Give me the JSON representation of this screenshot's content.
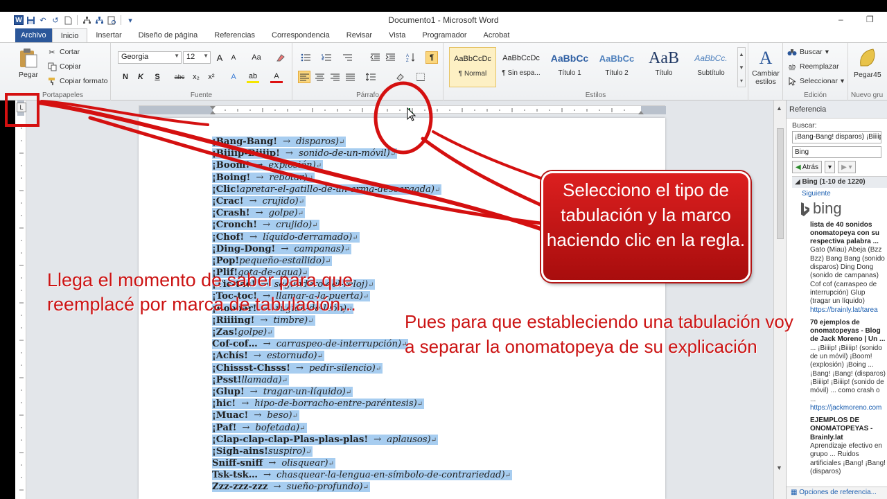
{
  "window": {
    "title": "Documento1 - Microsoft Word",
    "minimize": "–",
    "restore": "❐"
  },
  "qat": {
    "logo": "W",
    "undo": "↶",
    "redo": "↺"
  },
  "tabs": [
    {
      "label": "Archivo"
    },
    {
      "label": "Inicio"
    },
    {
      "label": "Insertar"
    },
    {
      "label": "Diseño de página"
    },
    {
      "label": "Referencias"
    },
    {
      "label": "Correspondencia"
    },
    {
      "label": "Revisar"
    },
    {
      "label": "Vista"
    },
    {
      "label": "Programador"
    },
    {
      "label": "Acrobat"
    }
  ],
  "ribbon": {
    "clipboard": {
      "label": "Portapapeles",
      "paste": "Pegar",
      "cut": "Cortar",
      "copy": "Copiar",
      "format_painter": "Copiar formato"
    },
    "font": {
      "label": "Fuente",
      "name": "Georgia",
      "size": "12",
      "grow": "A",
      "shrink": "A",
      "case": "Aa",
      "bold": "N",
      "italic": "K",
      "underline": "S",
      "strike": "abc",
      "sub": "x₂",
      "sup": "x²",
      "effects": "A",
      "highlight": "ab",
      "color": "A"
    },
    "paragraph": {
      "label": "Párrafo",
      "show_marks": "¶"
    },
    "styles": {
      "label": "Estilos",
      "items": [
        {
          "sample": "AaBbCcDc",
          "name": "¶ Normal"
        },
        {
          "sample": "AaBbCcDc",
          "name": "¶ Sin espa..."
        },
        {
          "sample": "AaBbCc",
          "name": "Título 1"
        },
        {
          "sample": "AaBbCc",
          "name": "Título 2"
        },
        {
          "sample": "AaB",
          "name": "Título"
        },
        {
          "sample": "AaBbCc.",
          "name": "Subtítulo"
        }
      ],
      "change": "Cambiar estilos"
    },
    "editing": {
      "label": "Edición",
      "find": "Buscar",
      "replace": "Reemplazar",
      "select": "Seleccionar"
    },
    "new_group": {
      "label": "Nuevo gru",
      "button": "Pegar45"
    }
  },
  "tab_selector": "L",
  "document": {
    "lines": [
      {
        "term": "¡Bang-Bang!",
        "desc": "disparos)",
        "arrow": "→"
      },
      {
        "term": "¡Biiiip-Biiiip!",
        "desc": "sonido-de-un-móvil)",
        "arrow": "→"
      },
      {
        "term": "¡Boom!",
        "desc": "explosión)",
        "arrow": "→"
      },
      {
        "term": "¡Boing!",
        "desc": "rebotar)",
        "arrow": "→"
      },
      {
        "term": "¡Clic!",
        "desc": "apretar-el-gatillo-de-un-arma-descargada)",
        "arrow": ""
      },
      {
        "term": "¡Crac!",
        "desc": "crujido)",
        "arrow": "→"
      },
      {
        "term": "¡Crash!",
        "desc": "golpe)",
        "arrow": "→"
      },
      {
        "term": "¡Cronch!",
        "desc": "crujido)",
        "arrow": "→"
      },
      {
        "term": "¡Chof!",
        "desc": "líquido-derramado)",
        "arrow": "→"
      },
      {
        "term": "¡Ding-Dong!",
        "desc": "campanas)",
        "arrow": "→"
      },
      {
        "term": "¡Pop!",
        "desc": "pequeño-estallido)",
        "arrow": ""
      },
      {
        "term": "¡Plif!",
        "desc": "gota-de-agua)",
        "arrow": ""
      },
      {
        "term": "¡Tic-tac!",
        "desc": "segundero-del-reloj)",
        "arrow": "→"
      },
      {
        "term": "¡Toc-toc!",
        "desc": "llamar-a-la-puerta)",
        "arrow": "→"
      },
      {
        "term": "¡Roooar!",
        "desc": "rugido-de-león)",
        "arrow": "→"
      },
      {
        "term": "¡Riiiing!",
        "desc": "timbre)",
        "arrow": "→"
      },
      {
        "term": "¡Zas!",
        "desc": "golpe)",
        "arrow": ""
      },
      {
        "term": "Cof-cof…",
        "desc": "carraspeo-de-interrupción)",
        "arrow": "→"
      },
      {
        "term": "¡Achís!",
        "desc": "estornudo)",
        "arrow": "→"
      },
      {
        "term": "¡Chissst-Chsss!",
        "desc": "pedir-silencio)",
        "arrow": "→"
      },
      {
        "term": "¡Psst!",
        "desc": "llamada)",
        "arrow": ""
      },
      {
        "term": "¡Glup!",
        "desc": "tragar-un-líquido)",
        "arrow": "→"
      },
      {
        "term": "¡hic!",
        "desc": "hipo-de-borracho-entre-paréntesis)",
        "arrow": "→"
      },
      {
        "term": "¡Muac!",
        "desc": "beso)",
        "arrow": "→"
      },
      {
        "term": "¡Paf!",
        "desc": "bofetada)",
        "arrow": "→"
      },
      {
        "term": "¡Clap-clap-clap-Plas-plas-plas!",
        "desc": "aplausos)",
        "arrow": "→"
      },
      {
        "term": "¡Sigh-ains!",
        "desc": "suspiro)",
        "arrow": ""
      },
      {
        "term": "Sniff-sniff",
        "desc": "olisquear)",
        "arrow": "→"
      },
      {
        "term": "Tsk-tsk…",
        "desc": "chasquear-la-lengua-en-símbolo-de-contrariedad)",
        "arrow": "→"
      },
      {
        "term": "Zzz-zzz-zzz",
        "desc": "sueño-profundo)",
        "arrow": "→"
      }
    ]
  },
  "research_pane": {
    "title": "Referencia",
    "search_label": "Buscar:",
    "search_value": "¡Bang-Bang! disparos) ¡Biiiip-",
    "source": "Bing",
    "back": "Atrás",
    "results_header": "Bing (1-10 de 1220)",
    "next": "Siguiente",
    "brand": "bing",
    "results": [
      {
        "title": "lista de 40 sonidos onomatopeya con su respectiva palabra ...",
        "body": "Gato (Miau) Abeja (Bzz Bzz) Bang Bang (sonido disparos) Ding Dong (sonido de campanas) Cof cof (carraspeo de interrupción) Glup (tragar un líquido)",
        "url": "https://brainly.lat/tarea"
      },
      {
        "title": "70 ejemplos de onomatopeyas - Blog de Jack Moreno | Un ...",
        "body": "... ¡Biiiip! ¡Biiiip! (sonido de un móvil) ¡Boom! (explosión) ¡Boing ... ¡Bang! ¡Bang! (disparos) ¡Biiiip! ¡Biiiip! (sonido de móvil) ... como crash o ...",
        "url": "https://jackmoreno.com"
      },
      {
        "title": "EJEMPLOS DE ONOMATOPEYAS - Brainly.lat",
        "body": "Aprendizaje efectivo en grupo ... Ruidos artificiales ¡Bang! ¡Bang! (disparos)",
        "url": ""
      }
    ],
    "footer": "Opciones de referencia..."
  },
  "annotations": {
    "callout": "Selecciono el tipo de tabulación y la marco haciendo clic en la regla.",
    "caption_left_1": "Llega el momento de saber  para que",
    "caption_left_2": "reemplacé por marca de tabulación...",
    "caption_right_1": "Pues para que estableciendo una tabulación voy",
    "caption_right_2": "a separar la onomatopeya de su explicación",
    "color": "#cc1414"
  }
}
